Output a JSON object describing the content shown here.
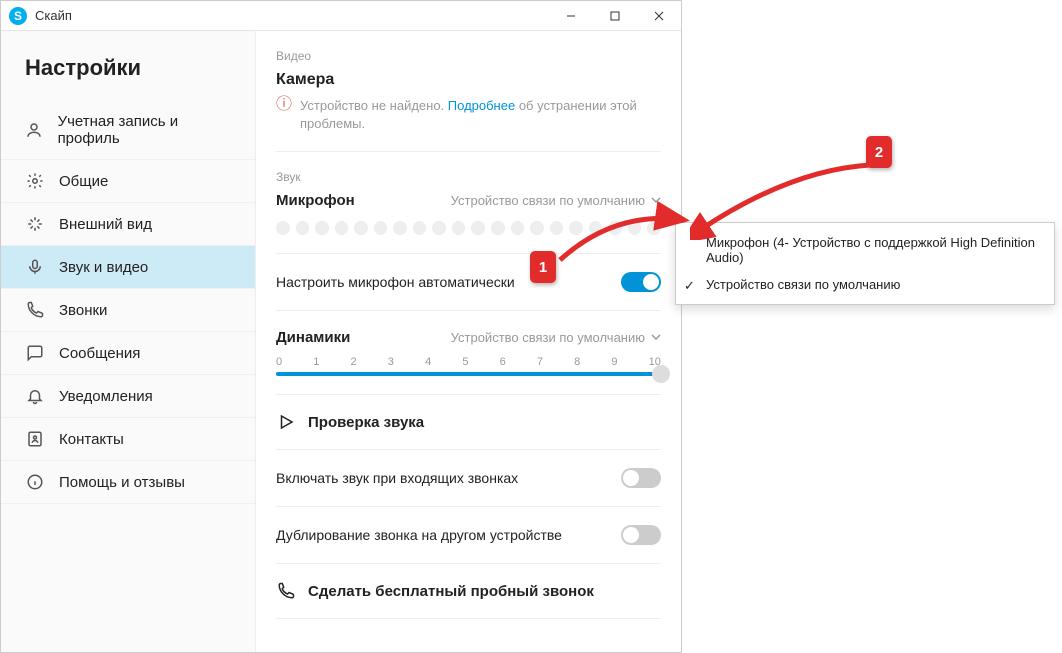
{
  "window": {
    "title": "Скайп"
  },
  "sidebar": {
    "heading": "Настройки",
    "items": [
      {
        "label": "Учетная запись и профиль"
      },
      {
        "label": "Общие"
      },
      {
        "label": "Внешний вид"
      },
      {
        "label": "Звук и видео"
      },
      {
        "label": "Звонки"
      },
      {
        "label": "Сообщения"
      },
      {
        "label": "Уведомления"
      },
      {
        "label": "Контакты"
      },
      {
        "label": "Помощь и отзывы"
      }
    ]
  },
  "video": {
    "section": "Видео",
    "title": "Камера",
    "notfound_prefix": "Устройство не найдено. ",
    "learn_more": "Подробнее",
    "notfound_suffix": " об устранении этой проблемы."
  },
  "audio": {
    "section": "Звук",
    "mic_title": "Микрофон",
    "mic_device": "Устройство связи по умолчанию",
    "auto_mic": "Настроить микрофон автоматически",
    "speakers_title": "Динамики",
    "speakers_device": "Устройство связи по умолчанию",
    "scale": [
      "0",
      "1",
      "2",
      "3",
      "4",
      "5",
      "6",
      "7",
      "8",
      "9",
      "10"
    ],
    "test_audio": "Проверка звука",
    "incoming_sound": "Включать звук при входящих звонках",
    "mirror_call": "Дублирование звонка на другом устройстве",
    "free_call": "Сделать бесплатный пробный звонок"
  },
  "popup": {
    "option1": "Микрофон (4- Устройство с поддержкой High Definition Audio)",
    "option2": "Устройство связи по умолчанию"
  },
  "callouts": {
    "one": "1",
    "two": "2"
  }
}
